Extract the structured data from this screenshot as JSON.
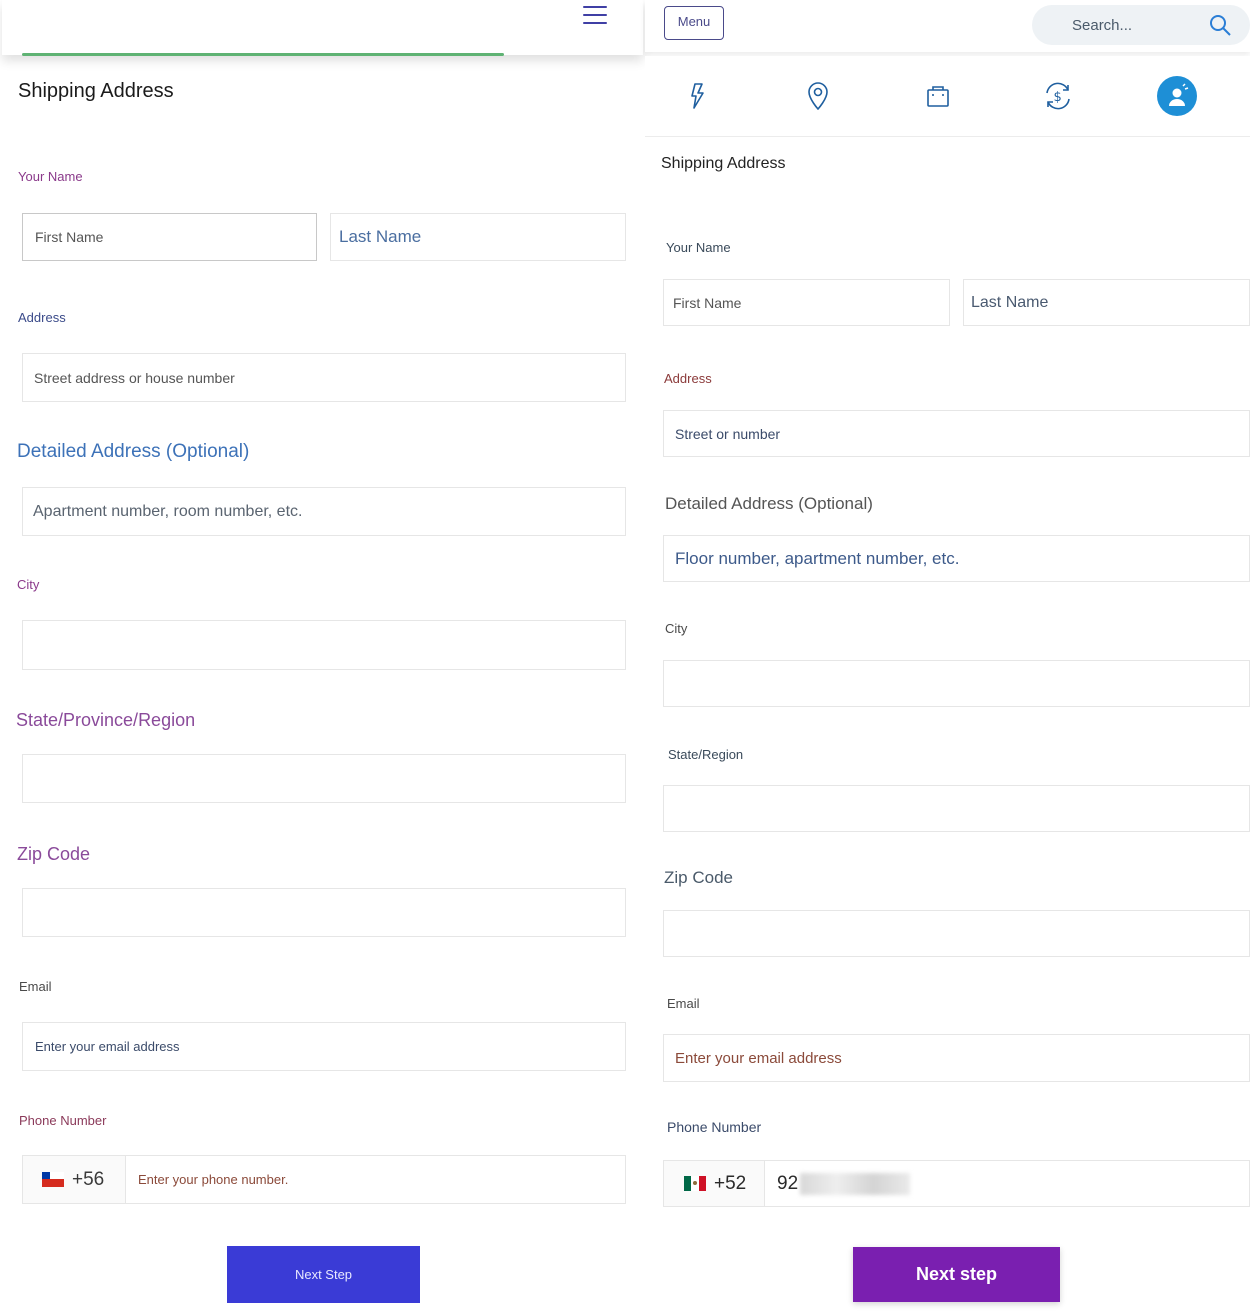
{
  "left": {
    "title": "Shipping Address",
    "labels": {
      "name": "Your Name",
      "address": "Address",
      "detailed": "Detailed Address (Optional)",
      "city": "City",
      "state": "State/Province/Region",
      "zip": "Zip Code",
      "email": "Email",
      "phone": "Phone Number"
    },
    "placeholders": {
      "first": "First Name",
      "last": "Last Name",
      "street": "Street address or house number",
      "detailed": "Apartment number, room number, etc.",
      "email": "Enter your email address",
      "phone": "Enter your phone number."
    },
    "phone_code": "+56",
    "next_button": "Next Step",
    "colors": {
      "button": "#3a3bd6",
      "progress": "#5fb374"
    }
  },
  "right": {
    "menu_button": "Menu",
    "search_placeholder": "Search...",
    "icons": [
      "flash-icon",
      "location-pin-icon",
      "shopping-bag-icon",
      "currency-exchange-icon",
      "account-icon"
    ],
    "title": "Shipping Address",
    "labels": {
      "name": "Your Name",
      "address": "Address",
      "detailed": "Detailed Address (Optional)",
      "city": "City",
      "state": "State/Region",
      "zip": "Zip Code",
      "email": "Email",
      "phone": "Phone Number"
    },
    "placeholders": {
      "first": "First Name",
      "last": "Last Name",
      "street": "Street or number",
      "detailed": "Floor number, apartment number, etc.",
      "email": "Enter your email address"
    },
    "phone_code": "+52",
    "phone_value": "92",
    "next_button": "Next step",
    "colors": {
      "button": "#7a1fb0",
      "active_icon": "#1e8fd6"
    }
  }
}
